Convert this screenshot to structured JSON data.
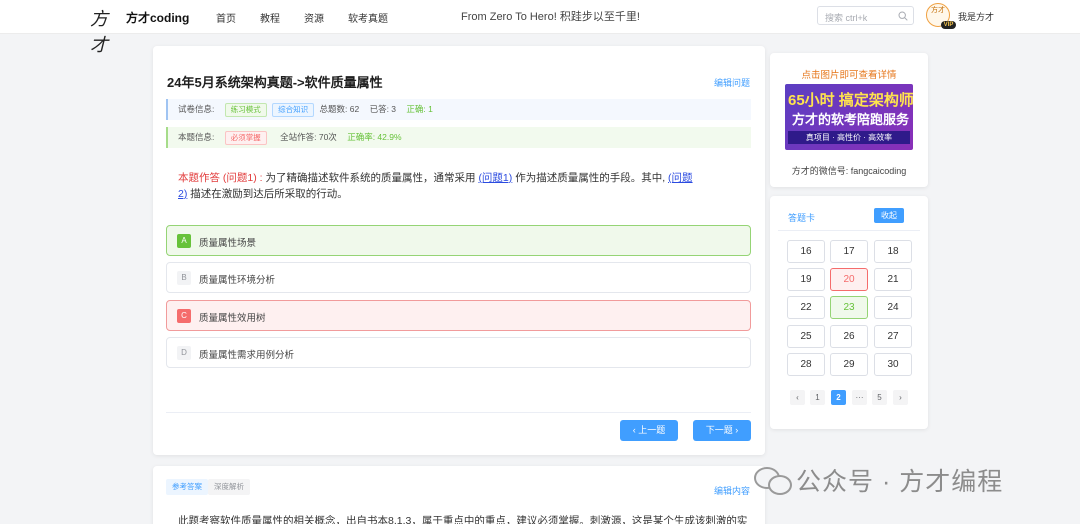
{
  "header": {
    "logo_mark": "方才",
    "logo_text": "方才coding",
    "nav": [
      "首页",
      "教程",
      "资源",
      "软考真题"
    ],
    "slogan": "From Zero To Hero! 积跬步以至千里!",
    "search_placeholder": "搜索 ctrl+k",
    "avatar_text": "方才",
    "vip_badge": "VIP",
    "username": "我是方才"
  },
  "question": {
    "title": "24年5月系统架构真题->软件质量属性",
    "edit_label": "编辑问题",
    "paper_info": {
      "label": "试卷信息:",
      "mode_tag": "练习模式",
      "type_tag": "综合知识",
      "total": "总题数: 62",
      "answered": "已答: 3",
      "correct": "正确: 1"
    },
    "item_info": {
      "label": "本题信息:",
      "must_tag": "必须掌握",
      "attempts": "全站作答: 70次",
      "rate": "正确率: 42.9%"
    },
    "stem": {
      "head": "本题作答 (问题1) :",
      "text1": "为了精确描述软件系统的质量属性，通常采用",
      "blank1": "(问题1)",
      "text2": "作为描述质量属性的手段。其中,",
      "blank2a": "(问题",
      "blank2b": "2)",
      "text3": "描述在激励到达后所采取的行动。"
    },
    "options": [
      {
        "letter": "A",
        "text": "质量属性场景",
        "state": "correct"
      },
      {
        "letter": "B",
        "text": "质量属性环境分析",
        "state": "normal"
      },
      {
        "letter": "C",
        "text": "质量属性效用树",
        "state": "wrong"
      },
      {
        "letter": "D",
        "text": "质量属性需求用例分析",
        "state": "normal"
      }
    ],
    "prev_label": "‹ 上一题",
    "next_label": "下一题 ›"
  },
  "sidebar": {
    "promo_title": "点击图片即可查看详情",
    "ad_line1": "65小时 搞定架构师",
    "ad_line2": "方才的软考陪跑服务",
    "ad_line3": "真项目 · 高性价 · 高效率",
    "wechat": "方才的微信号: fangcaicoding",
    "answer_card_title": "答题卡",
    "collapse_label": "收起",
    "numbers": [
      {
        "n": "16",
        "state": "normal"
      },
      {
        "n": "17",
        "state": "normal"
      },
      {
        "n": "18",
        "state": "normal"
      },
      {
        "n": "19",
        "state": "normal"
      },
      {
        "n": "20",
        "state": "wrong"
      },
      {
        "n": "21",
        "state": "normal"
      },
      {
        "n": "22",
        "state": "normal"
      },
      {
        "n": "23",
        "state": "right"
      },
      {
        "n": "24",
        "state": "normal"
      },
      {
        "n": "25",
        "state": "normal"
      },
      {
        "n": "26",
        "state": "normal"
      },
      {
        "n": "27",
        "state": "normal"
      },
      {
        "n": "28",
        "state": "normal"
      },
      {
        "n": "29",
        "state": "normal"
      },
      {
        "n": "30",
        "state": "normal"
      }
    ],
    "pagination": [
      "‹",
      "1",
      "2",
      "···",
      "5",
      "›"
    ],
    "current_page": "2"
  },
  "analysis": {
    "tab_answer": "参考答案",
    "tab_deep": "深度解析",
    "edit_label": "编辑内容",
    "text": "此题考察软件质量属性的相关概念，出自书本8.1.3，属于重点中的重点，建议必须掌握。刺激源，这是某个生成该刺激的实"
  },
  "watermark": "公众号 · 方才编程"
}
